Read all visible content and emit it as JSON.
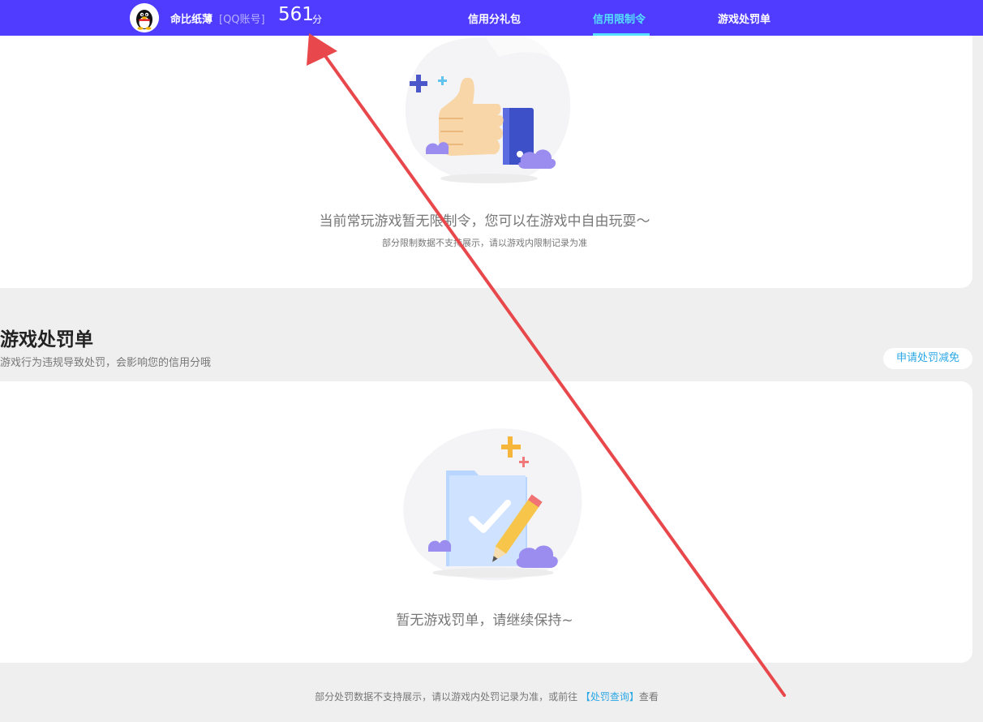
{
  "header": {
    "nickname": "命比纸薄",
    "account_type": "[QQ账号]",
    "score": "561",
    "score_unit": "分",
    "tabs": [
      {
        "label": "信用分礼包",
        "active": false
      },
      {
        "label": "信用限制令",
        "active": true
      },
      {
        "label": "游戏处罚单",
        "active": false
      }
    ],
    "accent_color": "#4f3cff",
    "active_color": "#55e0ff"
  },
  "restriction_card": {
    "message": "当前常玩游戏暂无限制令，您可以在游戏中自由玩耍～",
    "note": "部分限制数据不支持展示，请以游戏内限制记录为准",
    "illustration": "thumbs-up-illustration"
  },
  "penalty_section": {
    "title": "游戏处罚单",
    "description": "游戏行为违规导致处罚，会影响您的信用分哦",
    "appeal_button": "申请处罚减免"
  },
  "penalty_card": {
    "message": "暂无游戏罚单，请继续保持~",
    "illustration": "folder-check-pencil-illustration"
  },
  "footer": {
    "note_prefix": "部分处罚数据不支持展示，请以游戏内处罚记录为准，或前往 ",
    "link_text": "【处罚查询】",
    "note_suffix": "查看"
  },
  "annotation": {
    "type": "red-arrow",
    "color": "#e8484b"
  }
}
